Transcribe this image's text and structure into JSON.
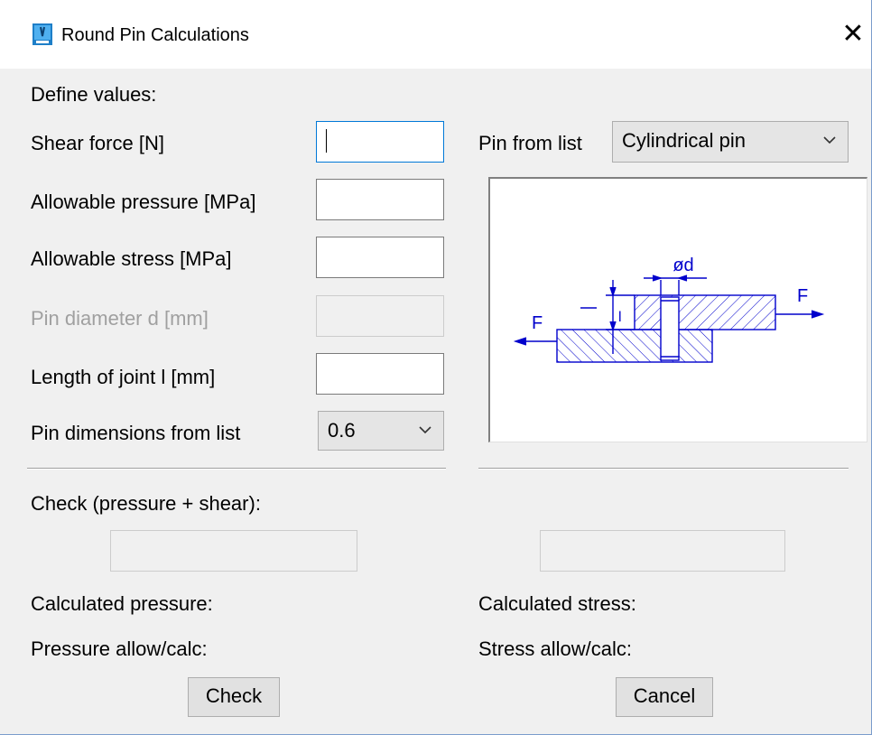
{
  "window": {
    "title": "Round Pin Calculations",
    "close_glyph": "✕"
  },
  "form": {
    "define_values": "Define values:",
    "shear_force_label": "Shear force [N]",
    "shear_force_value": "",
    "allowable_pressure_label": "Allowable pressure [MPa]",
    "allowable_pressure_value": "",
    "allowable_stress_label": "Allowable stress [MPa]",
    "allowable_stress_value": "",
    "pin_diameter_label": "Pin diameter d [mm]",
    "pin_diameter_value": "",
    "length_of_joint_label": "Length of joint l [mm]",
    "length_of_joint_value": "",
    "pin_dimensions_label": "Pin dimensions from list",
    "pin_dimensions_selected": "0.6"
  },
  "pin_list": {
    "label": "Pin from list",
    "selected": "Cylindrical pin"
  },
  "diagram": {
    "force_left": "F",
    "force_right": "F",
    "diameter_label": "ød",
    "length_label": "l",
    "line_color": "#0000cc"
  },
  "results": {
    "check_label": "Check (pressure + shear):",
    "check_result": "",
    "stress_result": "",
    "calculated_pressure_label": "Calculated pressure:",
    "pressure_ratio_label": "Pressure allow/calc:",
    "calculated_stress_label": "Calculated stress:",
    "stress_ratio_label": "Stress allow/calc:"
  },
  "buttons": {
    "check": "Check",
    "cancel": "Cancel"
  },
  "icons": {
    "app": "app-icon",
    "close": "close-icon",
    "dropdown": "chevron-down-icon"
  }
}
